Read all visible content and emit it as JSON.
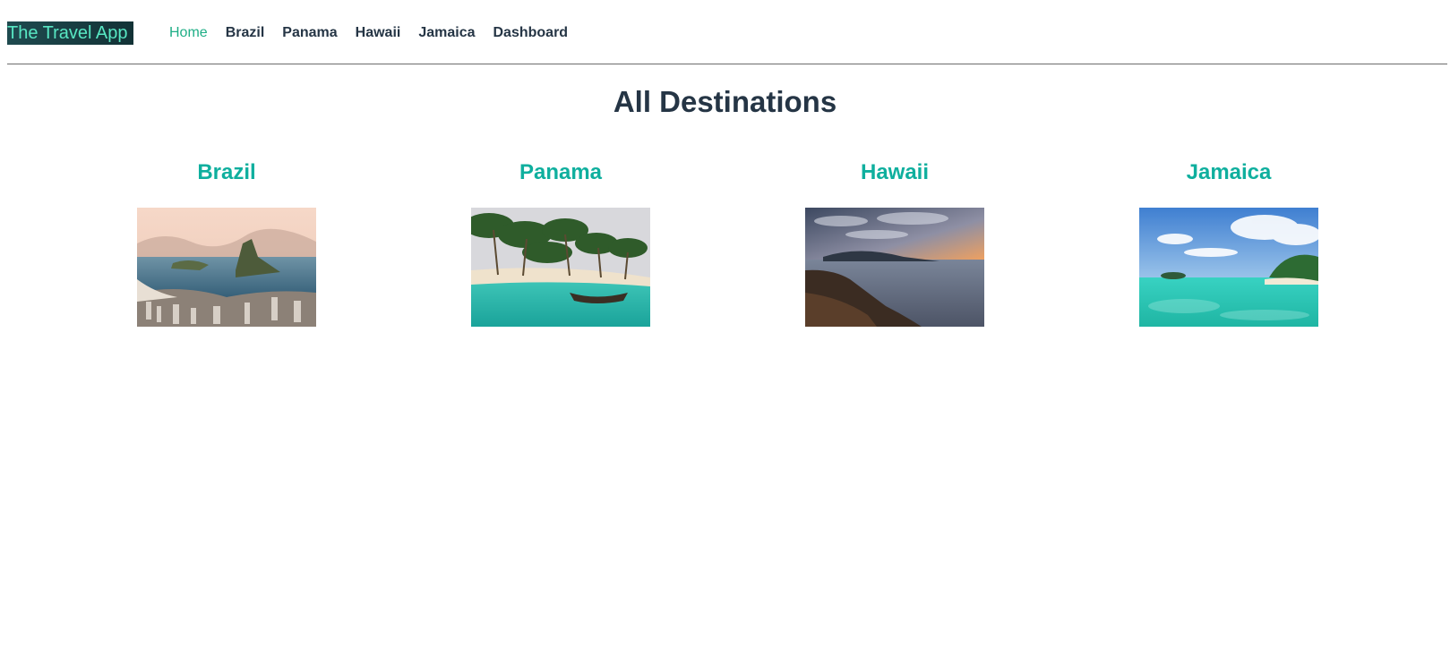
{
  "brand": "The Travel App",
  "nav": {
    "links": [
      "Home",
      "Brazil",
      "Panama",
      "Hawaii",
      "Jamaica",
      "Dashboard"
    ],
    "active": "Home"
  },
  "page_title": "All Destinations",
  "destinations": [
    {
      "name": "Brazil",
      "image": "rio-de-janeiro-bay-photo"
    },
    {
      "name": "Panama",
      "image": "palm-beach-canoe-photo"
    },
    {
      "name": "Hawaii",
      "image": "rocky-coast-sunset-photo"
    },
    {
      "name": "Jamaica",
      "image": "turquoise-lagoon-photo"
    }
  ],
  "colors": {
    "heading": "#253545",
    "accent": "#0faf9e",
    "active_nav": "#1fae86",
    "brand_text": "#58e7c3",
    "brand_bg": "#1f4a4f"
  }
}
